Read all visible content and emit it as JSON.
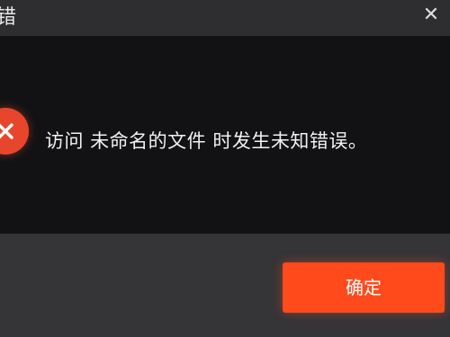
{
  "window": {
    "title": "错",
    "close_glyph": "✕"
  },
  "message": {
    "icon": "error-icon",
    "text": "访问 未命名的文件 时发生未知错误。"
  },
  "footer": {
    "confirm_label": "确定"
  },
  "colors": {
    "accent": "#ff4a1c",
    "error_icon": "#e8462c",
    "background": "#121214",
    "footer": "#353437"
  }
}
